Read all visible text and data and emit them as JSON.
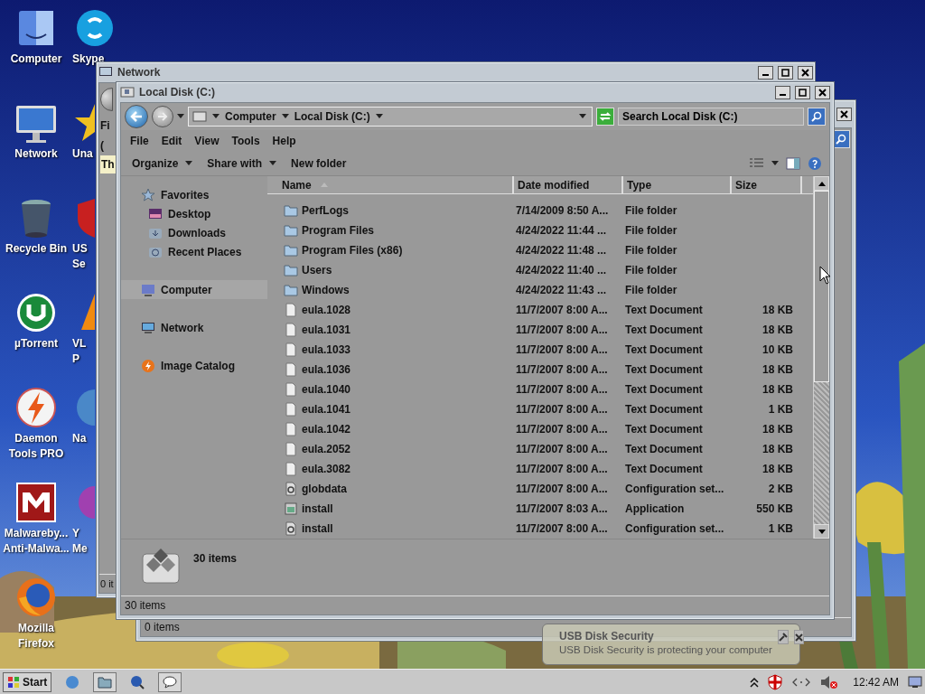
{
  "desktop_icons": [
    {
      "kind": "finder",
      "lines": [
        "Computer"
      ]
    },
    {
      "kind": "imac",
      "lines": [
        "Network"
      ]
    },
    {
      "kind": "bin",
      "lines": [
        "Recycle Bin"
      ]
    },
    {
      "kind": "utorrent",
      "lines": [
        "µTorrent"
      ]
    },
    {
      "kind": "daemon",
      "lines": [
        "Daemon",
        "Tools PRO"
      ]
    },
    {
      "kind": "malware",
      "lines": [
        "Malwareby...",
        "Anti-Malwa..."
      ]
    },
    {
      "kind": "firefox",
      "lines": [
        "Mozilla",
        "Firefox"
      ]
    }
  ],
  "covered_icons": [
    {
      "kind": "skype",
      "lines": [
        "Skype"
      ]
    },
    {
      "kind": "star",
      "lines": [
        "Una"
      ]
    },
    {
      "kind": "shield",
      "lines": [
        "US",
        "Se"
      ]
    },
    {
      "kind": "cone",
      "lines": [
        "VL",
        "P"
      ]
    },
    {
      "kind": "globe",
      "lines": [
        "Na"
      ]
    },
    {
      "kind": "orb",
      "lines": [
        "Y",
        "Me"
      ]
    }
  ],
  "back_window": {
    "status": "0 items"
  },
  "network_window": {
    "title": "Network",
    "menu_fragment": "Fi",
    "command_fragment": "(",
    "infobar_fragment": "Th",
    "status": "0 it"
  },
  "main_window": {
    "title": "Local Disk (C:)",
    "breadcrumb": [
      "Computer",
      "Local Disk (C:)"
    ],
    "search": {
      "placeholder": "Search Local Disk (C:)"
    },
    "menu": [
      "File",
      "Edit",
      "View",
      "Tools",
      "Help"
    ],
    "commands": [
      {
        "label": "Organize",
        "dropdown": true
      },
      {
        "label": "Share with",
        "dropdown": true
      },
      {
        "label": "New folder",
        "dropdown": false
      }
    ],
    "nav": [
      {
        "kind": "favorites",
        "label": "Favorites",
        "selected": false,
        "children": [
          {
            "kind": "desktop",
            "label": "Desktop",
            "selected": false
          },
          {
            "kind": "downloads",
            "label": "Downloads",
            "selected": false
          },
          {
            "kind": "recent",
            "label": "Recent Places",
            "selected": false
          }
        ]
      },
      {
        "kind": "computer",
        "label": "Computer",
        "selected": true
      },
      {
        "kind": "network",
        "label": "Network",
        "selected": false
      },
      {
        "kind": "catalog",
        "label": "Image Catalog",
        "selected": false
      }
    ],
    "columns": [
      {
        "label": "Name",
        "sorted": true
      },
      {
        "label": "Date modified",
        "sorted": false
      },
      {
        "label": "Type",
        "sorted": false
      },
      {
        "label": "Size",
        "sorted": false
      }
    ],
    "rows": [
      {
        "kind": "folder",
        "name": "PerfLogs",
        "date": "7/14/2009 8:50 A...",
        "type": "File folder"
      },
      {
        "kind": "folder",
        "name": "Program Files",
        "date": "4/24/2022 11:44 ...",
        "type": "File folder"
      },
      {
        "kind": "folder",
        "name": "Program Files (x86)",
        "date": "4/24/2022 11:48 ...",
        "type": "File folder"
      },
      {
        "kind": "folder",
        "name": "Users",
        "date": "4/24/2022 11:40 ...",
        "type": "File folder"
      },
      {
        "kind": "folder",
        "name": "Windows",
        "date": "4/24/2022 11:43 ...",
        "type": "File folder"
      },
      {
        "kind": "text",
        "name": "eula.1028",
        "date": "11/7/2007 8:00 A...",
        "type": "Text Document",
        "size": "18 KB"
      },
      {
        "kind": "text",
        "name": "eula.1031",
        "date": "11/7/2007 8:00 A...",
        "type": "Text Document",
        "size": "18 KB"
      },
      {
        "kind": "text",
        "name": "eula.1033",
        "date": "11/7/2007 8:00 A...",
        "type": "Text Document",
        "size": "10 KB"
      },
      {
        "kind": "text",
        "name": "eula.1036",
        "date": "11/7/2007 8:00 A...",
        "type": "Text Document",
        "size": "18 KB"
      },
      {
        "kind": "text",
        "name": "eula.1040",
        "date": "11/7/2007 8:00 A...",
        "type": "Text Document",
        "size": "18 KB"
      },
      {
        "kind": "text",
        "name": "eula.1041",
        "date": "11/7/2007 8:00 A...",
        "type": "Text Document",
        "size": "1 KB"
      },
      {
        "kind": "text",
        "name": "eula.1042",
        "date": "11/7/2007 8:00 A...",
        "type": "Text Document",
        "size": "18 KB"
      },
      {
        "kind": "text",
        "name": "eula.2052",
        "date": "11/7/2007 8:00 A...",
        "type": "Text Document",
        "size": "18 KB"
      },
      {
        "kind": "text",
        "name": "eula.3082",
        "date": "11/7/2007 8:00 A...",
        "type": "Text Document",
        "size": "18 KB"
      },
      {
        "kind": "config",
        "name": "globdata",
        "date": "11/7/2007 8:00 A...",
        "type": "Configuration set...",
        "size": "2 KB"
      },
      {
        "kind": "app",
        "name": "install",
        "date": "11/7/2007 8:03 A...",
        "type": "Application",
        "size": "550 KB"
      },
      {
        "kind": "config",
        "name": "install",
        "date": "11/7/2007 8:00 A...",
        "type": "Configuration set...",
        "size": "1 KB"
      }
    ],
    "details": {
      "count": "30 items"
    },
    "status": "30 items"
  },
  "notification": {
    "title": "USB Disk Security",
    "message": "USB Disk Security is protecting your computer"
  },
  "taskbar": {
    "start": "Start",
    "clock": "12:42 AM"
  }
}
